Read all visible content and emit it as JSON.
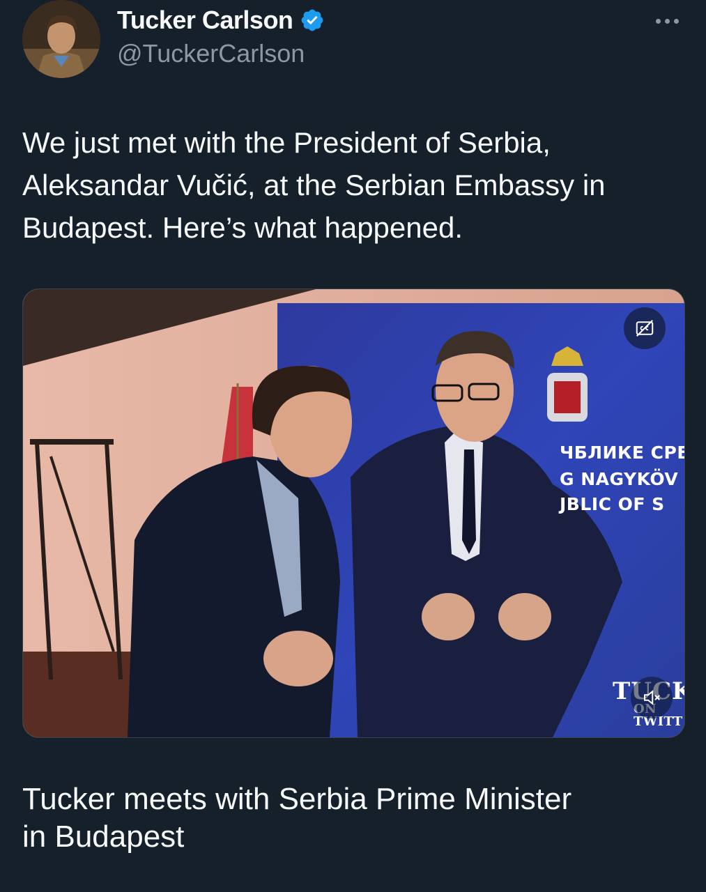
{
  "author": {
    "display_name": "Tucker Carlson",
    "handle": "@TuckerCarlson",
    "verified": true,
    "avatar_icon": "avatar-photo"
  },
  "tweet": {
    "text": "We just met with the President of Serbia,\nAleksandar Vučić, at the Serbian Embassy in\nBudapest. Here’s what happened."
  },
  "media": {
    "type": "video",
    "backdrop_lines": [
      "ЧБЛИКЕ СРБІ",
      "G NAGYKÖV",
      "JBLIC OF S"
    ],
    "watermark_top": "TUCK",
    "watermark_bottom": "ON TWITT",
    "captions_icon": "captions-icon",
    "mute_icon": "muted-speaker-icon"
  },
  "card": {
    "title": "Tucker meets with Serbia Prime Minister\nin Budapest"
  },
  "colors": {
    "background": "#15202b",
    "text": "#f7f9f9",
    "secondary": "#8b98a5",
    "verified_blue": "#1d9bf0"
  }
}
